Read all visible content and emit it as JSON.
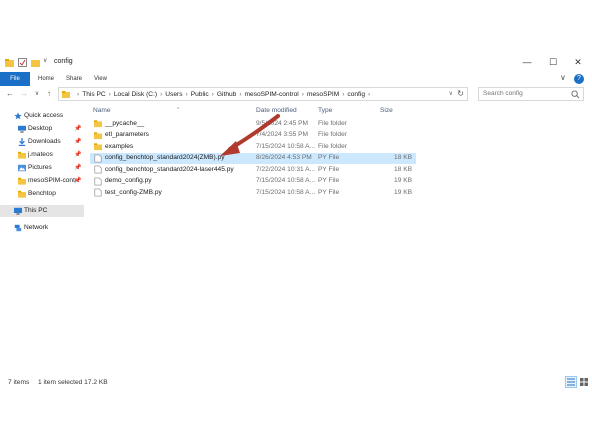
{
  "window": {
    "title": "config",
    "controls": {
      "minimize": "—",
      "maximize": "☐",
      "close": "✕"
    }
  },
  "ribbon": {
    "tabs": [
      "File",
      "Home",
      "Share",
      "View"
    ]
  },
  "address": {
    "crumbs": [
      "This PC",
      "Local Disk (C:)",
      "Users",
      "Public",
      "Github",
      "mesoSPIM-control",
      "mesoSPIM",
      "config"
    ],
    "search_placeholder": "Search config"
  },
  "sidebar": {
    "items": [
      {
        "label": "Quick access",
        "icon": "star-icon",
        "pinned": false
      },
      {
        "label": "Desktop",
        "icon": "desktop-icon",
        "pinned": true
      },
      {
        "label": "Downloads",
        "icon": "download-icon",
        "pinned": true
      },
      {
        "label": "j.mateos",
        "icon": "folder-icon",
        "pinned": true
      },
      {
        "label": "Pictures",
        "icon": "pictures-icon",
        "pinned": true
      },
      {
        "label": "mesoSPIM-contr",
        "icon": "folder-icon",
        "pinned": true
      },
      {
        "label": "Benchtop",
        "icon": "folder-icon",
        "pinned": false
      },
      {
        "label": "This PC",
        "icon": "pc-icon",
        "pinned": false
      },
      {
        "label": "Network",
        "icon": "network-icon",
        "pinned": false
      }
    ]
  },
  "columns": {
    "name": "Name",
    "date": "Date modified",
    "type": "Type",
    "size": "Size"
  },
  "files": [
    {
      "name": "__pycache__",
      "date": "9/5/2024 2:45 PM",
      "type": "File folder",
      "size": "",
      "kind": "folder"
    },
    {
      "name": "etl_parameters",
      "date": "7/4/2024 3:55 PM",
      "type": "File folder",
      "size": "",
      "kind": "folder"
    },
    {
      "name": "examples",
      "date": "7/15/2024 10:58 A...",
      "type": "File folder",
      "size": "",
      "kind": "folder"
    },
    {
      "name": "config_benchtop_standard2024(ZMB).py",
      "date": "8/26/2024 4:53 PM",
      "type": "PY File",
      "size": "18 KB",
      "kind": "file"
    },
    {
      "name": "config_benchtop_standard2024-laser445.py",
      "date": "7/22/2024 10:31 A...",
      "type": "PY File",
      "size": "18 KB",
      "kind": "file"
    },
    {
      "name": "demo_config.py",
      "date": "7/15/2024 10:58 A...",
      "type": "PY File",
      "size": "19 KB",
      "kind": "file"
    },
    {
      "name": "test_config-ZMB.py",
      "date": "7/15/2024 10:58 A...",
      "type": "PY File",
      "size": "19 KB",
      "kind": "file"
    }
  ],
  "status": {
    "count": "7 items",
    "selection": "1 item selected  17.2 KB"
  },
  "colors": {
    "accent": "#1a6fc7",
    "selection": "#cce8ff",
    "folder": "#f4c542",
    "arrow": "#b03a2e"
  }
}
